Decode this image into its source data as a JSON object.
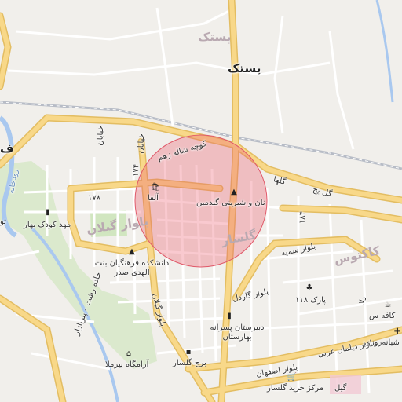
{
  "colors": {
    "background": "#f1efeb",
    "major_road": "#f8d889",
    "major_road_casing": "#e3bd62",
    "minor_road": "#ffffff",
    "green": "#c9e4b5",
    "river": "#a9c8ef",
    "railway": "#b7bcc6",
    "circle_fill": "rgba(236,92,108,0.35)",
    "circle_stroke": "#e05a6a"
  },
  "labels": {
    "district_petsak_faint": "پستک",
    "district_petsak": "پستک",
    "district_kaktus": "کاکتوس",
    "district_golsar": "گلسار",
    "district_fa": "ف",
    "blvd_gilan": "بلوار گیلان",
    "kuche_shahrzad": "کوچه شاله زهم",
    "golha": "گلها",
    "gol_yakh": "گل یخ",
    "street_a": "خیابان",
    "street_b": "خیابان",
    "street_174": "۱۷۴",
    "street_178": "۱۷۸",
    "street_184": "۱۸۴",
    "street_gilan": "بلوار گیلان",
    "blvd_samiye": "بلوار سمیه",
    "blvd_gaardel": "بلوار گاردل",
    "blvd_deylaman": "بلوار دیلمان غربی",
    "blvd_esfahan": "بلوار اصفهان",
    "blvd_jade": "جاده رشت - پیربازار",
    "river_name": "رودخانه",
    "ta_left": "تو",
    "dala": "دلا"
  },
  "pois": {
    "alfa": "آلفا",
    "nan_shirini": "نان و شیرینی گندمین",
    "mahd_koodak": "مهد کودک بهار",
    "daneshkadeh": "دانشکده فرهنگیان بنت الهدی صدر",
    "park": "پارک ۱۱۸",
    "dabirestan": "دبیرستان پسرانه بهارستان",
    "borj_golsar": "برج گلسار",
    "aramgah": "آرامگاه پیرملا",
    "markaz_kharid": "مرکز خرید گلسار",
    "cafe": "کافه س",
    "shabane_roozi": "شبانه‌روزی",
    "gil": "گیل"
  }
}
